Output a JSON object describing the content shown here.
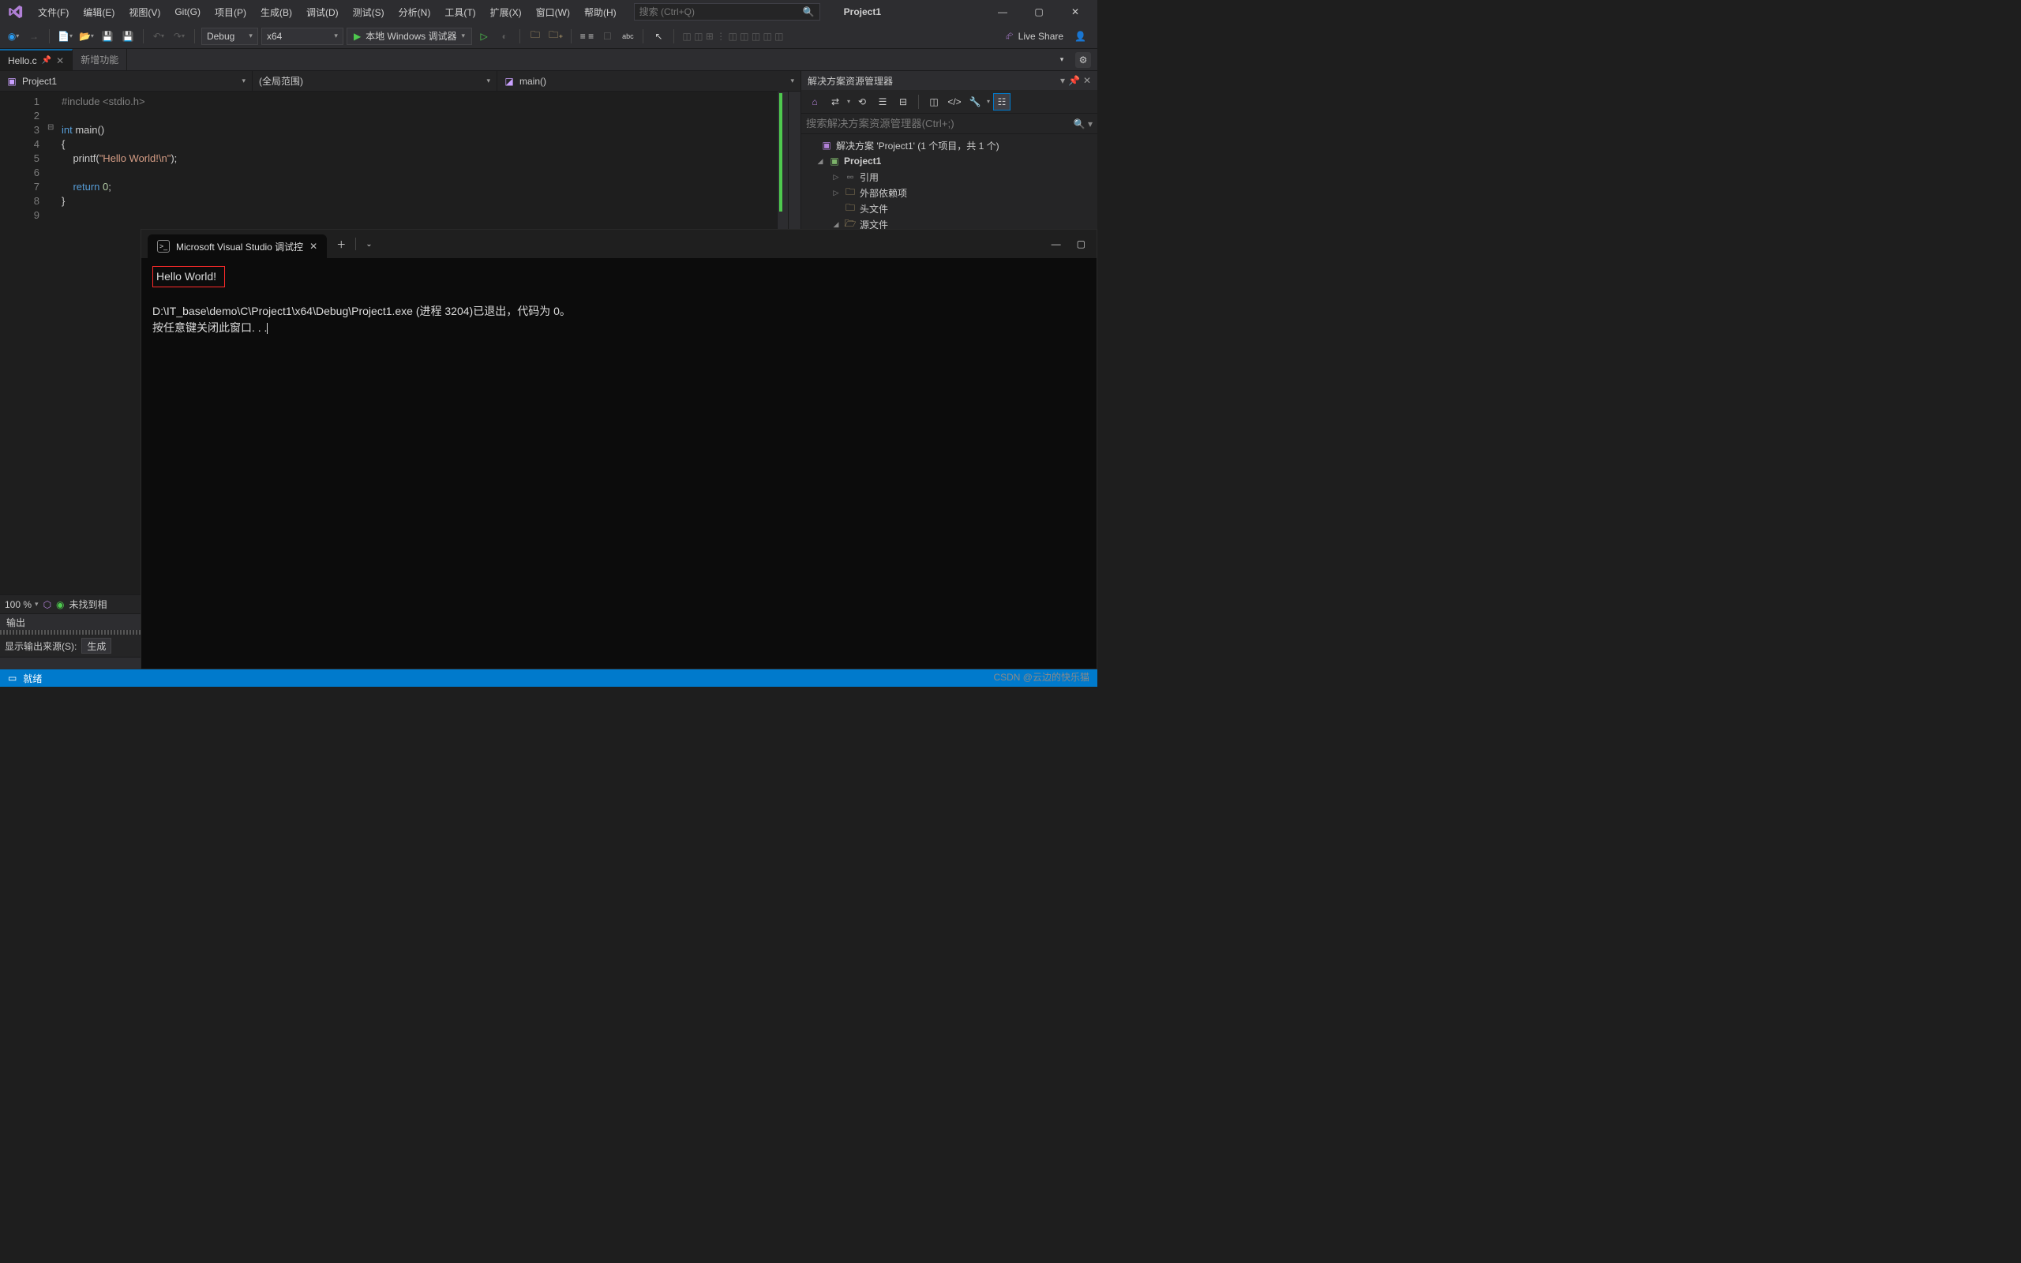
{
  "menubar": {
    "items": [
      "文件(F)",
      "编辑(E)",
      "视图(V)",
      "Git(G)",
      "项目(P)",
      "生成(B)",
      "调试(D)",
      "测试(S)",
      "分析(N)",
      "工具(T)",
      "扩展(X)",
      "窗口(W)",
      "帮助(H)"
    ],
    "search_placeholder": "搜索 (Ctrl+Q)",
    "project_label": "Project1"
  },
  "toolbar": {
    "config": "Debug",
    "platform": "x64",
    "run_label": "本地 Windows 调试器",
    "liveshare": "Live Share"
  },
  "tabs": {
    "active": "Hello.c",
    "other": "新增功能"
  },
  "editor_nav": {
    "project": "Project1",
    "scope": "(全局范围)",
    "function": "main()"
  },
  "code_lines": [
    "1",
    "2",
    "3",
    "4",
    "5",
    "6",
    "7",
    "8",
    "9"
  ],
  "code": {
    "l1_pre": "#include ",
    "l1_inc": "<stdio.h>",
    "l3_kw": "int",
    "l3_rest": " main()",
    "l4": "{",
    "l5a": "    printf(",
    "l5b": "\"Hello World!\\n\"",
    "l5c": ");",
    "l7a": "    ",
    "l7kw": "return",
    "l7sp": " ",
    "l7num": "0",
    "l7c": ";",
    "l8": "}"
  },
  "zoom": {
    "value": "100 %",
    "errors": "未找到相"
  },
  "output": {
    "title": "输出",
    "source_label": "显示输出来源(S):",
    "source_value": "生成"
  },
  "solution_explorer": {
    "title": "解决方案资源管理器",
    "search_placeholder": "搜索解决方案资源管理器(Ctrl+;)",
    "solution": "解决方案 'Project1' (1 个项目，共 1 个)",
    "project": "Project1",
    "nodes": {
      "references": "引用",
      "external": "外部依赖项",
      "headers": "头文件",
      "sources": "源文件"
    }
  },
  "status": {
    "ready": "就绪"
  },
  "console": {
    "tab_title": "Microsoft Visual Studio 调试控",
    "output_line": "Hello World!",
    "exit_line": "D:\\IT_base\\demo\\C\\Project1\\x64\\Debug\\Project1.exe (进程 3204)已退出，代码为 0。",
    "prompt_line": "按任意键关闭此窗口. . ."
  },
  "watermark": "CSDN @云边的快乐猫"
}
